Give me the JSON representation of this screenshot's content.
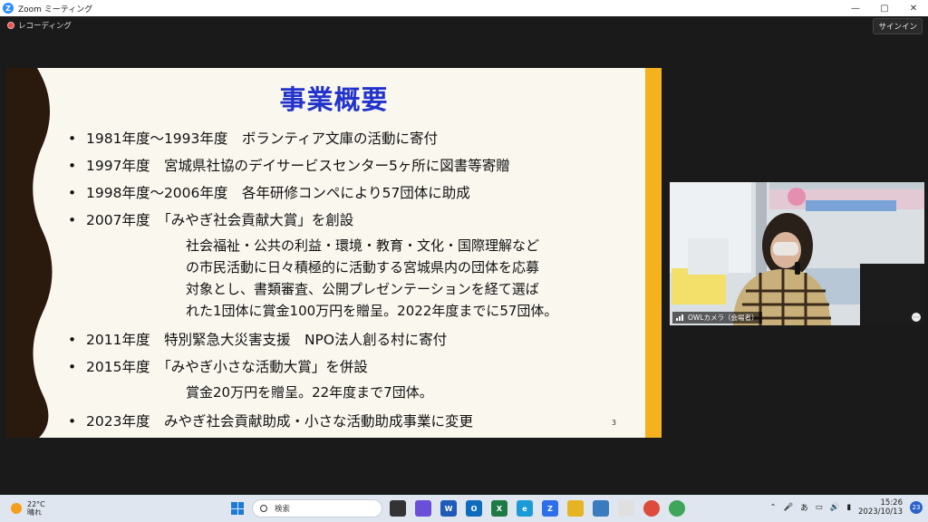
{
  "window": {
    "title": "Zoom ミーティング",
    "controls": [
      "—",
      "▢",
      "✕"
    ]
  },
  "zoom": {
    "recording_label": "レコーディング",
    "signin_label": "サインイン"
  },
  "slide": {
    "title": "事業概要",
    "bullets": [
      "1981年度〜1993年度　ボランティア文庫の活動に寄付",
      "1997年度　宮城県社協のデイサービスセンター5ヶ所に図書等寄贈",
      "1998年度〜2006年度　各年研修コンペにより57団体に助成",
      "2007年度　「みやぎ社会貢献大賞」を創設",
      "2011年度　特別緊急大災害支援　NPO法人創る村に寄付",
      "2015年度　「みやぎ小さな活動大賞」を併設",
      "2023年度　みやぎ社会貢献助成・小さな活動助成事業に変更"
    ],
    "desc_2007": [
      "社会福祉・公共の利益・環境・教育・文化・国際理解など",
      "の市民活動に日々積極的に活動する宮城県内の団体を応募",
      "対象とし、書類審査、公開プレゼンテーションを経て選ば",
      "れた1団体に賞金100万円を贈呈。2022年度までに57団体。"
    ],
    "desc_2015": "賞金20万円を贈呈。22年度まで7団体。",
    "page_number": "3",
    "bullet_char": "•"
  },
  "video": {
    "participant_label": "OWLカメラ（会場者）",
    "more_icon": "⋯"
  },
  "taskbar": {
    "weather_temp": "22°C",
    "weather_desc": "晴れ",
    "search_placeholder": "検索",
    "ime_label": "あ",
    "time": "15:26",
    "date": "2023/10/13",
    "notification_count": "23"
  },
  "colors": {
    "slide_title": "#2233cc",
    "gold_bar": "#f5b21e",
    "wave": "#2a1a0e"
  }
}
